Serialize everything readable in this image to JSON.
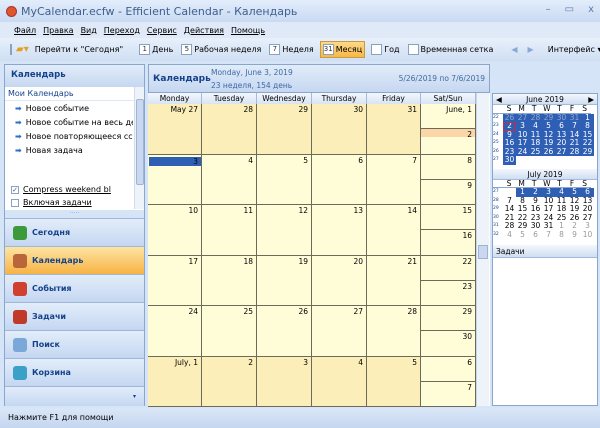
{
  "window": {
    "title": "MyCalendar.ecfw - Efficient Calendar - Календарь",
    "minimize": "–",
    "maximize": "▭",
    "close": "x"
  },
  "menu": [
    "Файл",
    "Правка",
    "Вид",
    "Переход",
    "Сервис",
    "Действия",
    "Помощь"
  ],
  "toolbar": {
    "goto_today": "Перейти к \"Сегодня\"",
    "views": [
      {
        "icon": "1",
        "label": "День"
      },
      {
        "icon": "5",
        "label": "Рабочая неделя"
      },
      {
        "icon": "7",
        "label": "Неделя"
      },
      {
        "icon": "31",
        "label": "Месяц",
        "active": true
      },
      {
        "icon": "",
        "label": "Год"
      },
      {
        "icon": "",
        "label": "Временная сетка"
      }
    ],
    "interface": "Интерфейс ▾"
  },
  "sidebar": {
    "title": "Календарь",
    "section": "Мои Календарь",
    "tasks": [
      "Новое событие",
      "Новое событие на весь де",
      "Новое повторяющееся сс",
      "Новая задача"
    ],
    "options": [
      {
        "label": "Compress weekend bl",
        "checked": true
      },
      {
        "label": "Включая задачи",
        "checked": false
      }
    ],
    "nav": [
      {
        "label": "Сегодня",
        "color": "#3d9a3a"
      },
      {
        "label": "Календарь",
        "color": "#b9673a",
        "active": true
      },
      {
        "label": "События",
        "color": "#d04030"
      },
      {
        "label": "Задачи",
        "color": "#c0392b"
      },
      {
        "label": "Поиск",
        "color": "#7aa8d8"
      },
      {
        "label": "Корзина",
        "color": "#3aa0c8"
      }
    ]
  },
  "main": {
    "title": "Календарь",
    "date": "Monday, June 3, 2019",
    "week_info": "23 неделя, 154 день",
    "range": "5/26/2019 по 7/6/2019",
    "columns": [
      "Monday",
      "Tuesday",
      "Wednesday",
      "Thursday",
      "Friday",
      "Sat/Sun"
    ],
    "weeks": [
      {
        "days": [
          "May 27",
          "28",
          "29",
          "30",
          "31"
        ],
        "sat": "June, 1",
        "sun": "2",
        "other": true
      },
      {
        "days": [
          "3",
          "4",
          "5",
          "6",
          "7"
        ],
        "sat": "8",
        "sun": "9",
        "selected": 0
      },
      {
        "days": [
          "10",
          "11",
          "12",
          "13",
          "14"
        ],
        "sat": "15",
        "sun": "16"
      },
      {
        "days": [
          "17",
          "18",
          "19",
          "20",
          "21"
        ],
        "sat": "22",
        "sun": "23"
      },
      {
        "days": [
          "24",
          "25",
          "26",
          "27",
          "28"
        ],
        "sat": "29",
        "sun": "30"
      },
      {
        "days": [
          "July, 1",
          "2",
          "3",
          "4",
          "5"
        ],
        "sat": "6",
        "sun": "7",
        "other": true
      }
    ],
    "colors": {
      "current": "#fffcd8",
      "other": "#fbeeb8",
      "selected": "#2f5fb5",
      "today_row": "#fbd7a8"
    }
  },
  "minical": {
    "dow": [
      "S",
      "M",
      "T",
      "W",
      "T",
      "F",
      "S"
    ],
    "months": [
      {
        "title": "June 2019",
        "weeks": [
          {
            "n": "22",
            "d": [
              "26",
              "27",
              "28",
              "29",
              "30",
              "31",
              "1"
            ]
          },
          {
            "n": "23",
            "d": [
              "2",
              "3",
              "4",
              "5",
              "6",
              "7",
              "8"
            ]
          },
          {
            "n": "24",
            "d": [
              "9",
              "10",
              "11",
              "12",
              "13",
              "14",
              "15"
            ]
          },
          {
            "n": "25",
            "d": [
              "16",
              "17",
              "18",
              "19",
              "20",
              "21",
              "22"
            ]
          },
          {
            "n": "26",
            "d": [
              "23",
              "24",
              "25",
              "26",
              "27",
              "28",
              "29"
            ]
          },
          {
            "n": "27",
            "d": [
              "30",
              "",
              "",
              "",
              "",
              "",
              ""
            ]
          }
        ]
      },
      {
        "title": "July 2019",
        "weeks": [
          {
            "n": "27",
            "d": [
              "",
              "1",
              "2",
              "3",
              "4",
              "5",
              "6"
            ]
          },
          {
            "n": "28",
            "d": [
              "7",
              "8",
              "9",
              "10",
              "11",
              "12",
              "13"
            ]
          },
          {
            "n": "29",
            "d": [
              "14",
              "15",
              "16",
              "17",
              "18",
              "19",
              "20"
            ]
          },
          {
            "n": "30",
            "d": [
              "21",
              "22",
              "23",
              "24",
              "25",
              "26",
              "27"
            ]
          },
          {
            "n": "31",
            "d": [
              "28",
              "29",
              "30",
              "31",
              "1",
              "2",
              "3"
            ]
          },
          {
            "n": "32",
            "d": [
              "4",
              "5",
              "6",
              "7",
              "8",
              "9",
              "10"
            ]
          }
        ]
      }
    ],
    "tasks_label": "Задачи",
    "highlight": "#2f5fb5"
  },
  "status": "Нажмите F1 для помощи"
}
